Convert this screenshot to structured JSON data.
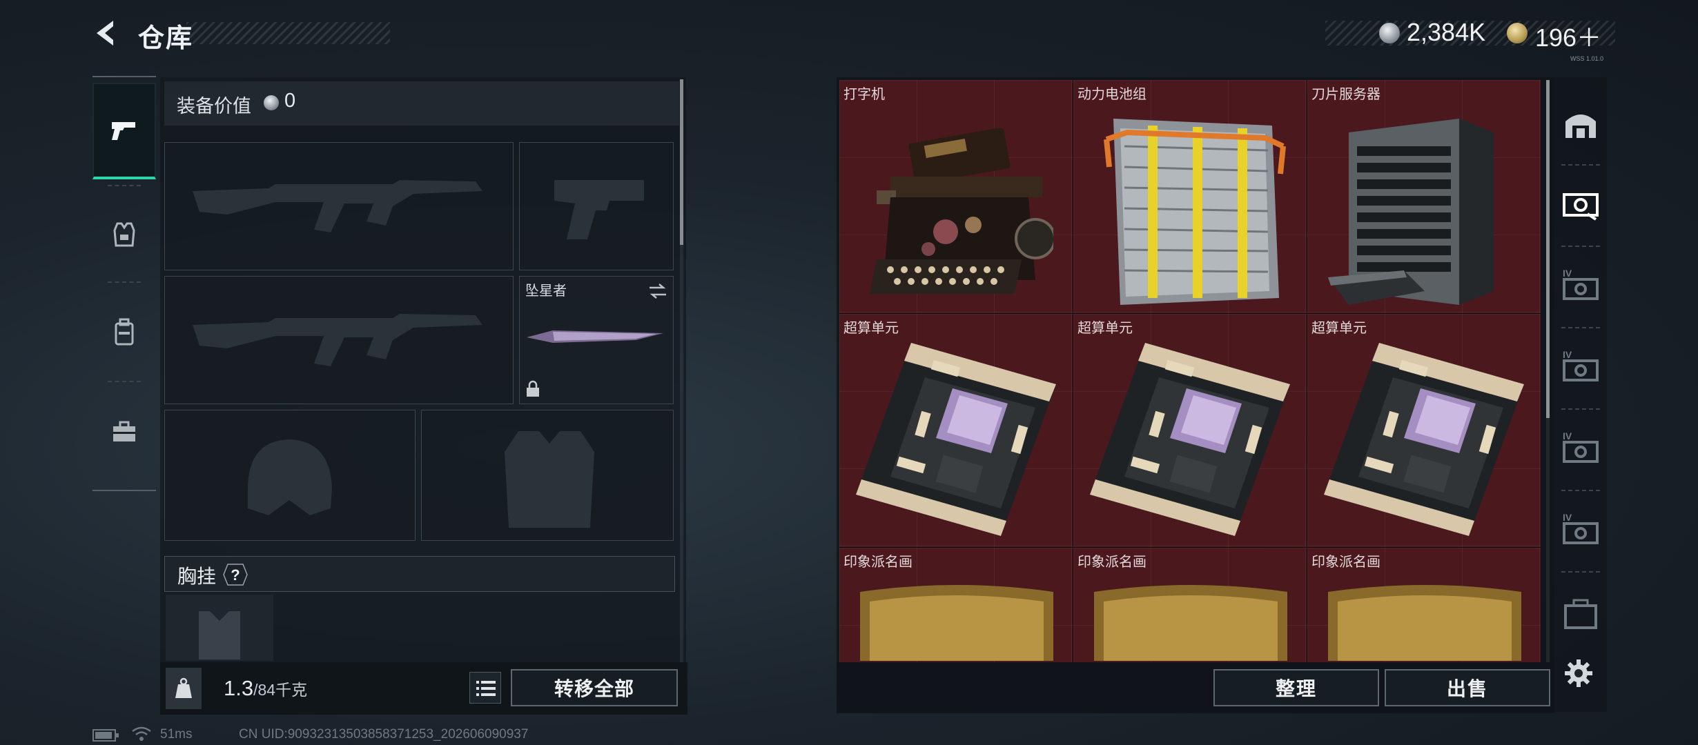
{
  "header": {
    "title": "仓库",
    "back_icon": "back-arrow-icon"
  },
  "currency": {
    "silver_amount": "2,384K",
    "silver_icon": "silver-coin-icon",
    "gold_amount": "196＋",
    "gold_icon": "gold-coin-icon",
    "tiny_code": "WSS 1.01.0"
  },
  "side_tabs": [
    {
      "name": "weapons-tab",
      "icon": "pistol-icon",
      "active": true
    },
    {
      "name": "armor-tab",
      "icon": "armor-vest-icon",
      "active": false
    },
    {
      "name": "backpack-tab",
      "icon": "backpack-icon",
      "active": false
    },
    {
      "name": "toolbox-tab",
      "icon": "toolbox-icon",
      "active": false
    }
  ],
  "equipment": {
    "value_label": "装备价值",
    "value": "0",
    "melee_slot_label": "坠星者",
    "chest_rig_label": "胸挂",
    "help_label": "?"
  },
  "weight": {
    "current": "1.3",
    "max": "/84千克"
  },
  "buttons": {
    "transfer_all": "转移全部",
    "organize": "整理",
    "sell": "出售"
  },
  "warehouse": {
    "items": [
      {
        "label": "打字机",
        "icon": "typewriter-icon"
      },
      {
        "label": "动力电池组",
        "icon": "battery-pack-icon"
      },
      {
        "label": "刀片服务器",
        "icon": "blade-server-icon"
      },
      {
        "label": "超算单元",
        "icon": "computing-unit-icon"
      },
      {
        "label": "超算单元",
        "icon": "computing-unit-icon"
      },
      {
        "label": "超算单元",
        "icon": "computing-unit-icon"
      },
      {
        "label": "印象派名画",
        "icon": "painting-icon"
      },
      {
        "label": "印象派名画",
        "icon": "painting-icon"
      },
      {
        "label": "印象派名画",
        "icon": "painting-icon"
      }
    ],
    "background_color": "#4a181d"
  },
  "rail": {
    "tier_label": "IV"
  },
  "status_bar": {
    "ping": "51ms",
    "uid": "CN UID:9093231350385837125​3_202606090937"
  },
  "colors": {
    "accent": "#2fd6a7",
    "panel": "#12181d"
  }
}
